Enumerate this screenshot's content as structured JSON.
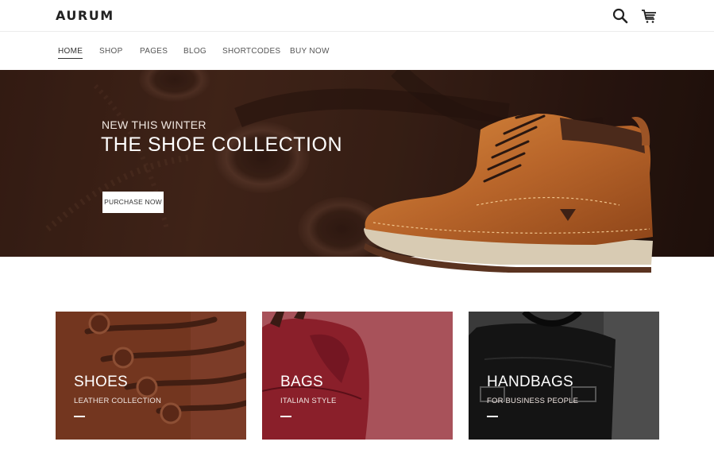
{
  "header": {
    "logo": "AURUM",
    "icons": {
      "search": "search-icon",
      "cart": "cart-icon"
    }
  },
  "nav": {
    "items": [
      {
        "label": "HOME",
        "active": true
      },
      {
        "label": "SHOP"
      },
      {
        "label": "PAGES"
      },
      {
        "label": "BLOG"
      },
      {
        "label": "SHORTCODES"
      },
      {
        "label": "BUY NOW"
      }
    ]
  },
  "hero": {
    "kicker": "NEW THIS WINTER",
    "title": "THE SHOE COLLECTION",
    "button": "PURCHASE NOW"
  },
  "cards": [
    {
      "title": "SHOES",
      "subtitle": "LEATHER COLLECTION",
      "color": "#7a3b22"
    },
    {
      "title": "BAGS",
      "subtitle": "ITALIAN STYLE",
      "color": "#a8525a"
    },
    {
      "title": "HANDBAGS",
      "subtitle": "FOR BUSINESS PEOPLE",
      "color": "#2a2a2a"
    }
  ],
  "colors": {
    "accent": "#333333",
    "hero_bg": "#3e2419"
  }
}
